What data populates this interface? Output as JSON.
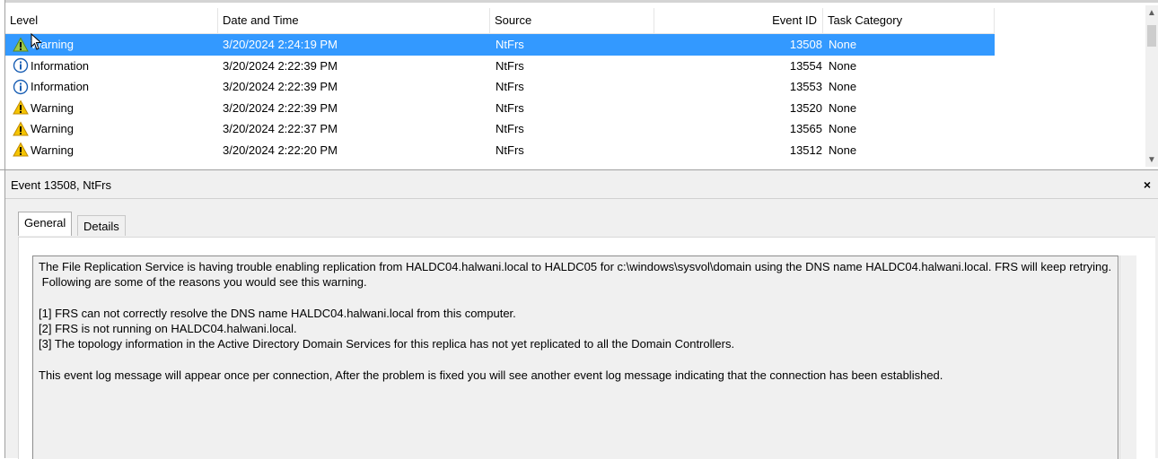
{
  "list": {
    "columns": [
      "Level",
      "Date and Time",
      "Source",
      "Event ID",
      "Task Category"
    ],
    "rows": [
      {
        "level": "Warning",
        "icon": "warning-icon",
        "date": "3/20/2024 2:24:19 PM",
        "source": "NtFrs",
        "event_id": "13508",
        "task": "None",
        "selected": true
      },
      {
        "level": "Information",
        "icon": "information-icon",
        "date": "3/20/2024 2:22:39 PM",
        "source": "NtFrs",
        "event_id": "13554",
        "task": "None",
        "selected": false
      },
      {
        "level": "Information",
        "icon": "information-icon",
        "date": "3/20/2024 2:22:39 PM",
        "source": "NtFrs",
        "event_id": "13553",
        "task": "None",
        "selected": false
      },
      {
        "level": "Warning",
        "icon": "warning-icon",
        "date": "3/20/2024 2:22:39 PM",
        "source": "NtFrs",
        "event_id": "13520",
        "task": "None",
        "selected": false
      },
      {
        "level": "Warning",
        "icon": "warning-icon",
        "date": "3/20/2024 2:22:37 PM",
        "source": "NtFrs",
        "event_id": "13565",
        "task": "None",
        "selected": false
      },
      {
        "level": "Warning",
        "icon": "warning-icon",
        "date": "3/20/2024 2:22:20 PM",
        "source": "NtFrs",
        "event_id": "13512",
        "task": "None",
        "selected": false
      }
    ]
  },
  "details": {
    "title": "Event 13508, NtFrs",
    "close_label": "×",
    "tabs": [
      "General",
      "Details"
    ],
    "active_tab": "General",
    "message": "The File Replication Service is having trouble enabling replication from HALDC04.halwani.local to HALDC05 for c:\\windows\\sysvol\\domain using the DNS name HALDC04.halwani.local. FRS will keep retrying.\n Following are some of the reasons you would see this warning.\n\n[1] FRS can not correctly resolve the DNS name HALDC04.halwani.local from this computer.\n[2] FRS is not running on HALDC04.halwani.local.\n[3] The topology information in the Active Directory Domain Services for this replica has not yet replicated to all the Domain Controllers.\n\nThis event log message will appear once per connection, After the problem is fixed you will see another event log message indicating that the connection has been established."
  },
  "colors": {
    "selection": "#3399ff",
    "warning_yellow": "#f5c400",
    "info_blue": "#1a5fb4"
  }
}
